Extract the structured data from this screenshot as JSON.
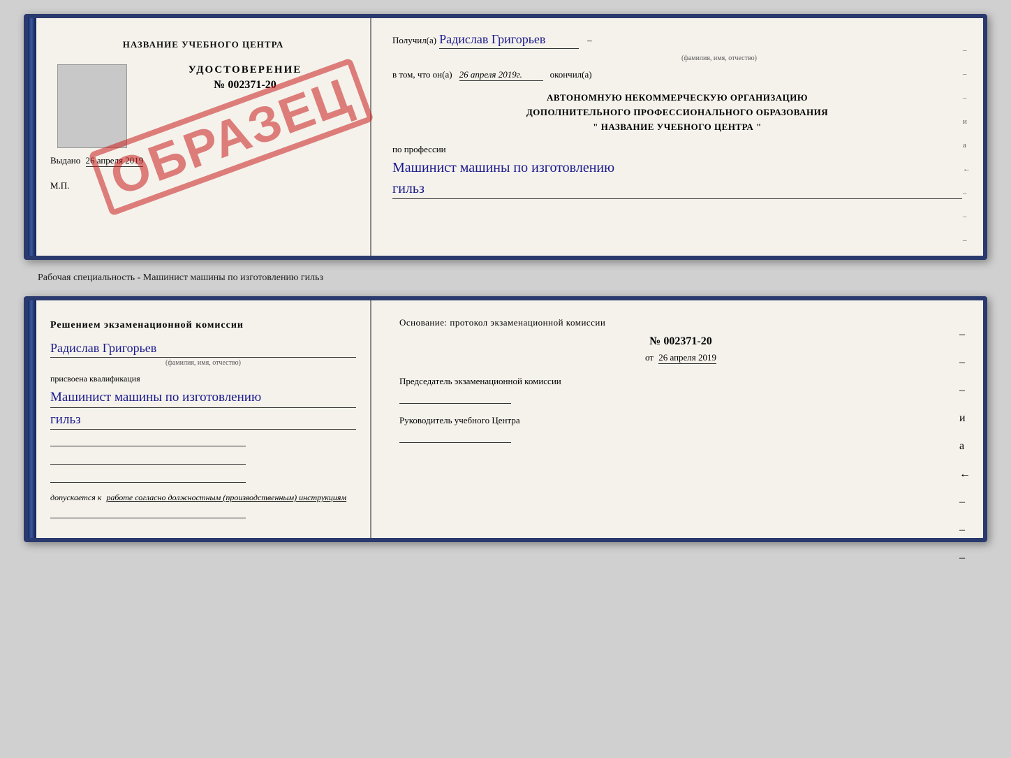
{
  "top_cert": {
    "left": {
      "org_title": "НАЗВАНИЕ УЧЕБНОГО ЦЕНТРА",
      "cert_id_label": "УДОСТОВЕРЕНИЕ",
      "cert_id_number": "№ 002371-20",
      "issued_label": "Выдано",
      "issued_date": "26 апреля 2019",
      "mp_label": "М.П.",
      "stamp_text": "ОБРАЗЕЦ"
    },
    "right": {
      "received_label": "Получил(а)",
      "person_name": "Радислав Григорьев",
      "name_caption": "(фамилия, имя, отчество)",
      "date_prefix": "в том, что он(а)",
      "date_value": "26 апреля 2019г.",
      "date_suffix": "окончил(а)",
      "org_line1": "АВТОНОМНУЮ НЕКОММЕРЧЕСКУЮ ОРГАНИЗАЦИЮ",
      "org_line2": "ДОПОЛНИТЕЛЬНОГО ПРОФЕССИОНАЛЬНОГО ОБРАЗОВАНИЯ",
      "org_line3": "\" НАЗВАНИЕ УЧЕБНОГО ЦЕНТРА \"",
      "profession_label": "по профессии",
      "profession_handwritten": "Машинист машины по изготовлению",
      "profession_handwritten2": "гильз"
    }
  },
  "bottom_label": "Рабочая специальность - Машинист машины по изготовлению гильз",
  "bottom_cert": {
    "left": {
      "decision_text": "Решением экзаменационной комиссии",
      "person_name": "Радислав Григорьев",
      "name_caption": "(фамилия, имя, отчество)",
      "assigned_label": "присвоена квалификация",
      "qualification_line1": "Машинист машины по изготовлению",
      "qualification_line2": "гильз",
      "allowed_label": "допускается к",
      "allowed_text": "работе согласно должностным (производственным) инструкциям"
    },
    "right": {
      "osnov_label": "Основание: протокол экзаменационной комиссии",
      "protocol_number": "№ 002371-20",
      "protocol_date_prefix": "от",
      "protocol_date": "26 апреля 2019",
      "chairman_label": "Председатель экзаменационной комиссии",
      "center_head_label": "Руководитель учебного Центра"
    }
  },
  "right_side_indicators": [
    "-",
    "-",
    "-",
    "и",
    "а",
    "←",
    "-",
    "-",
    "-"
  ],
  "right_side_indicators_bottom": [
    "-",
    "-",
    "-",
    "и",
    "а",
    "←",
    "-",
    "-",
    "-"
  ]
}
